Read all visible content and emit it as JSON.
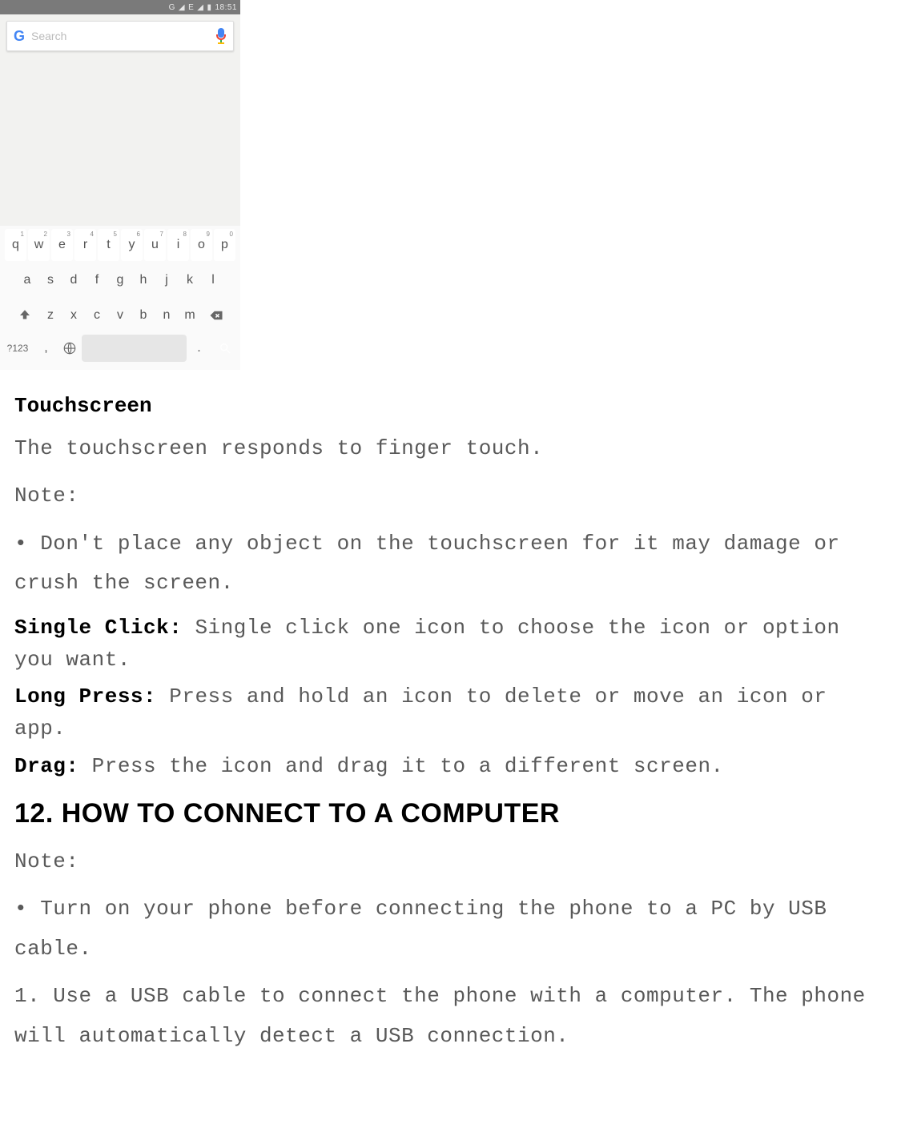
{
  "phone": {
    "status": {
      "network": "G",
      "signal": "◢",
      "extra": "E",
      "signal2": "◢",
      "battery": "▮",
      "time": "18:51"
    },
    "search": {
      "placeholder": "Search"
    },
    "keyboard": {
      "row1": [
        {
          "k": "q",
          "n": "1"
        },
        {
          "k": "w",
          "n": "2"
        },
        {
          "k": "e",
          "n": "3"
        },
        {
          "k": "r",
          "n": "4"
        },
        {
          "k": "t",
          "n": "5"
        },
        {
          "k": "y",
          "n": "6"
        },
        {
          "k": "u",
          "n": "7"
        },
        {
          "k": "i",
          "n": "8"
        },
        {
          "k": "o",
          "n": "9"
        },
        {
          "k": "p",
          "n": "0"
        }
      ],
      "row2": [
        "a",
        "s",
        "d",
        "f",
        "g",
        "h",
        "j",
        "k",
        "l"
      ],
      "row3": [
        "z",
        "x",
        "c",
        "v",
        "b",
        "n",
        "m"
      ],
      "symKey": "?123",
      "comma": ",",
      "period": "."
    }
  },
  "doc": {
    "h_touchscreen": "Touchscreen",
    "p_responds": "The touchscreen responds to finger touch.",
    "p_note1": "Note:",
    "p_bullet1": "• Don't place any object on the touchscreen for it may damage or crush the screen.",
    "lbl_single": "Single Click: ",
    "p_single": "Single click one icon to choose the icon or option you want.",
    "lbl_long": "Long Press: ",
    "p_long": "Press and hold an icon to delete or move an icon or app.",
    "lbl_drag": "Drag: ",
    "p_drag": "Press the icon and drag it to a different screen.",
    "h_section12": "12. HOW TO CONNECT TO A COMPUTER",
    "p_note2": "Note:",
    "p_bullet2": "• Turn on your phone before connecting the phone to a PC by USB cable.",
    "p_step1": "1. Use a USB cable to connect the phone with a computer. The phone will automatically detect a USB connection."
  }
}
